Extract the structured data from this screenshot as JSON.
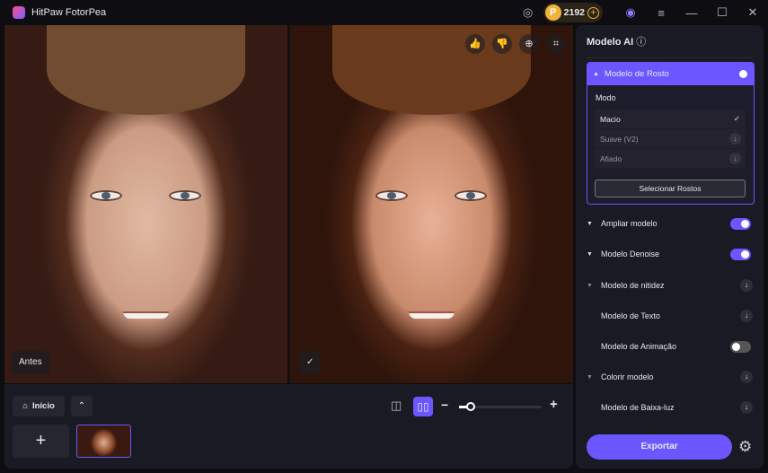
{
  "app": {
    "title": "HitPaw FotorPea",
    "credits": "2192"
  },
  "viewer": {
    "before_label": "Antes",
    "after_label": "✓"
  },
  "bottom": {
    "home_label": "Início",
    "add_label": "+"
  },
  "panel": {
    "title": "Modelo AI",
    "face_model": {
      "label": "Modelo de Rosto",
      "enabled": true,
      "mode_label": "Modo",
      "options": [
        {
          "label": "Macio",
          "selected": true
        },
        {
          "label": "Suave (V2)",
          "selected": false
        },
        {
          "label": "Afiado",
          "selected": false
        }
      ],
      "select_faces": "Selecionar Rostos"
    },
    "models": [
      {
        "label": "Ampliar modelo",
        "control": "toggle",
        "enabled": true,
        "arrow": "▼"
      },
      {
        "label": "Modelo Denoise",
        "control": "toggle",
        "enabled": true,
        "arrow": "▼"
      },
      {
        "label": "Modelo de nitidez",
        "control": "download",
        "arrow": "▼"
      },
      {
        "label": "Modelo de Texto",
        "control": "download",
        "arrow": ""
      },
      {
        "label": "Modelo de Animação",
        "control": "toggle",
        "enabled": false,
        "arrow": ""
      },
      {
        "label": "Colorir modelo",
        "control": "download",
        "arrow": "▼"
      },
      {
        "label": "Modelo de Baixa-luz",
        "control": "download",
        "arrow": ""
      }
    ],
    "export_label": "Exportar"
  },
  "colors": {
    "accent": "#6b56ff"
  }
}
